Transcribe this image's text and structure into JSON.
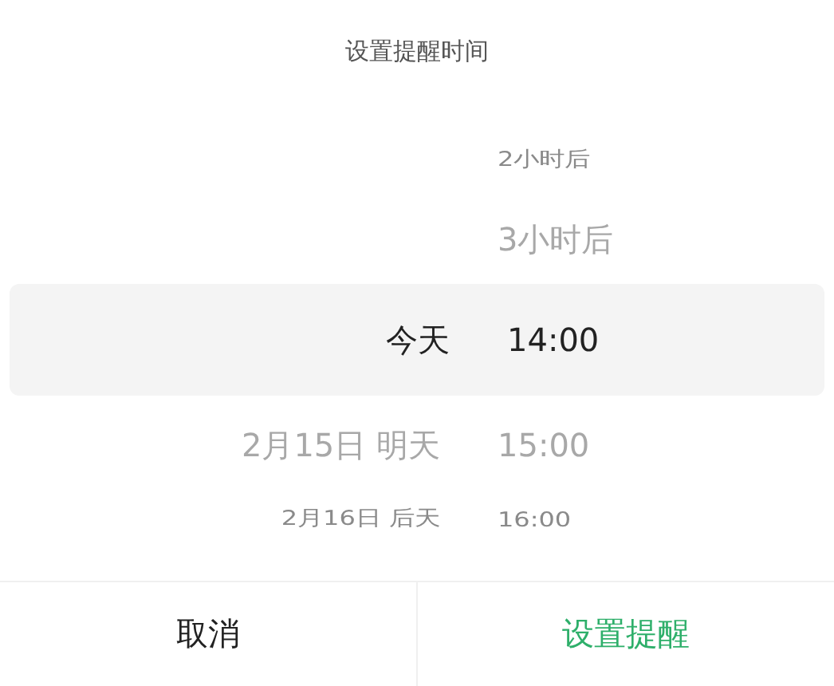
{
  "title": "设置提醒时间",
  "picker_rows": [
    {
      "date": "",
      "time": "2小时后",
      "selected": false
    },
    {
      "date": "",
      "time": "3小时后",
      "selected": false
    },
    {
      "date": "今天",
      "time": "14:00",
      "selected": true
    },
    {
      "date": "2月15日 明天",
      "time": "15:00",
      "selected": false
    },
    {
      "date": "2月16日 后天",
      "time": "16:00",
      "selected": false
    }
  ],
  "buttons": [
    {
      "label": "取消",
      "kind": "cancel"
    },
    {
      "label": "设置提醒",
      "kind": "confirm"
    }
  ]
}
